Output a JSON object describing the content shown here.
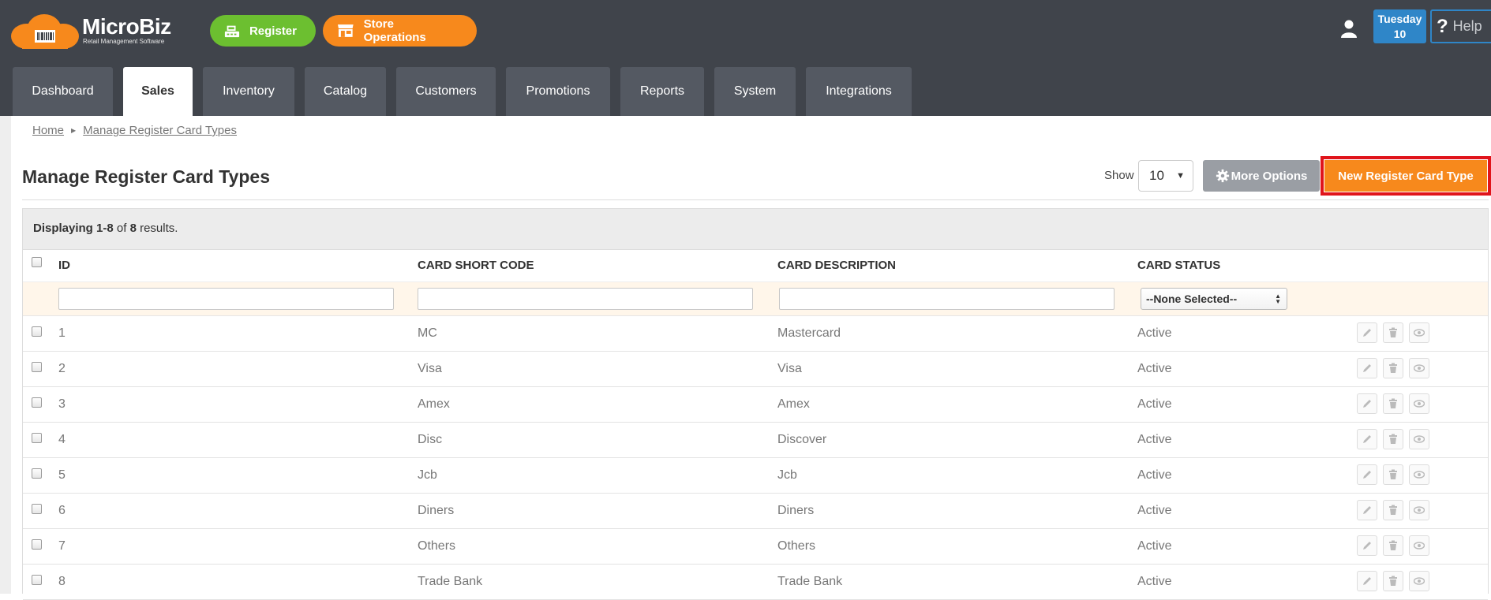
{
  "brand": {
    "title": "MicroBiz",
    "subtitle": "Retail Management Software"
  },
  "header": {
    "register_label": "Register",
    "store_ops_label": "Store Operations",
    "date_day": "Tuesday",
    "date_num": "10",
    "help_label": "Help",
    "help_mark": "?"
  },
  "tabs": [
    {
      "label": "Dashboard"
    },
    {
      "label": "Sales",
      "active": true
    },
    {
      "label": "Inventory"
    },
    {
      "label": "Catalog"
    },
    {
      "label": "Customers"
    },
    {
      "label": "Promotions"
    },
    {
      "label": "Reports"
    },
    {
      "label": "System"
    },
    {
      "label": "Integrations"
    }
  ],
  "breadcrumb": {
    "home": "Home",
    "current": "Manage Register Card Types"
  },
  "page": {
    "title": "Manage Register Card Types",
    "show_label": "Show",
    "show_value": "10",
    "more_options_label": "More Options",
    "new_button_label": "New Register Card Type"
  },
  "summary": {
    "prefix": "Displaying",
    "range": "1-8",
    "of": "of",
    "total": "8",
    "suffix": "results."
  },
  "table": {
    "columns": {
      "id": "ID",
      "code": "CARD SHORT CODE",
      "desc": "CARD DESCRIPTION",
      "status": "CARD STATUS"
    },
    "status_filter_value": "--None Selected--",
    "rows": [
      {
        "id": "1",
        "code": "MC",
        "desc": "Mastercard",
        "status": "Active"
      },
      {
        "id": "2",
        "code": "Visa",
        "desc": "Visa",
        "status": "Active"
      },
      {
        "id": "3",
        "code": "Amex",
        "desc": "Amex",
        "status": "Active"
      },
      {
        "id": "4",
        "code": "Disc",
        "desc": "Discover",
        "status": "Active"
      },
      {
        "id": "5",
        "code": "Jcb",
        "desc": "Jcb",
        "status": "Active"
      },
      {
        "id": "6",
        "code": "Diners",
        "desc": "Diners",
        "status": "Active"
      },
      {
        "id": "7",
        "code": "Others",
        "desc": "Others",
        "status": "Active"
      },
      {
        "id": "8",
        "code": "Trade Bank",
        "desc": "Trade Bank",
        "status": "Active"
      }
    ]
  },
  "colors": {
    "header_bg": "#40444b",
    "tab_bg": "#545962",
    "green": "#6cbf30",
    "orange": "#f7891c",
    "blue": "#2f86c8",
    "highlight": "#e0141b"
  },
  "icons": {
    "user": "user-icon",
    "gear": "gear-icon",
    "edit": "pencil-icon",
    "delete": "trash-icon",
    "view": "eye-icon"
  }
}
